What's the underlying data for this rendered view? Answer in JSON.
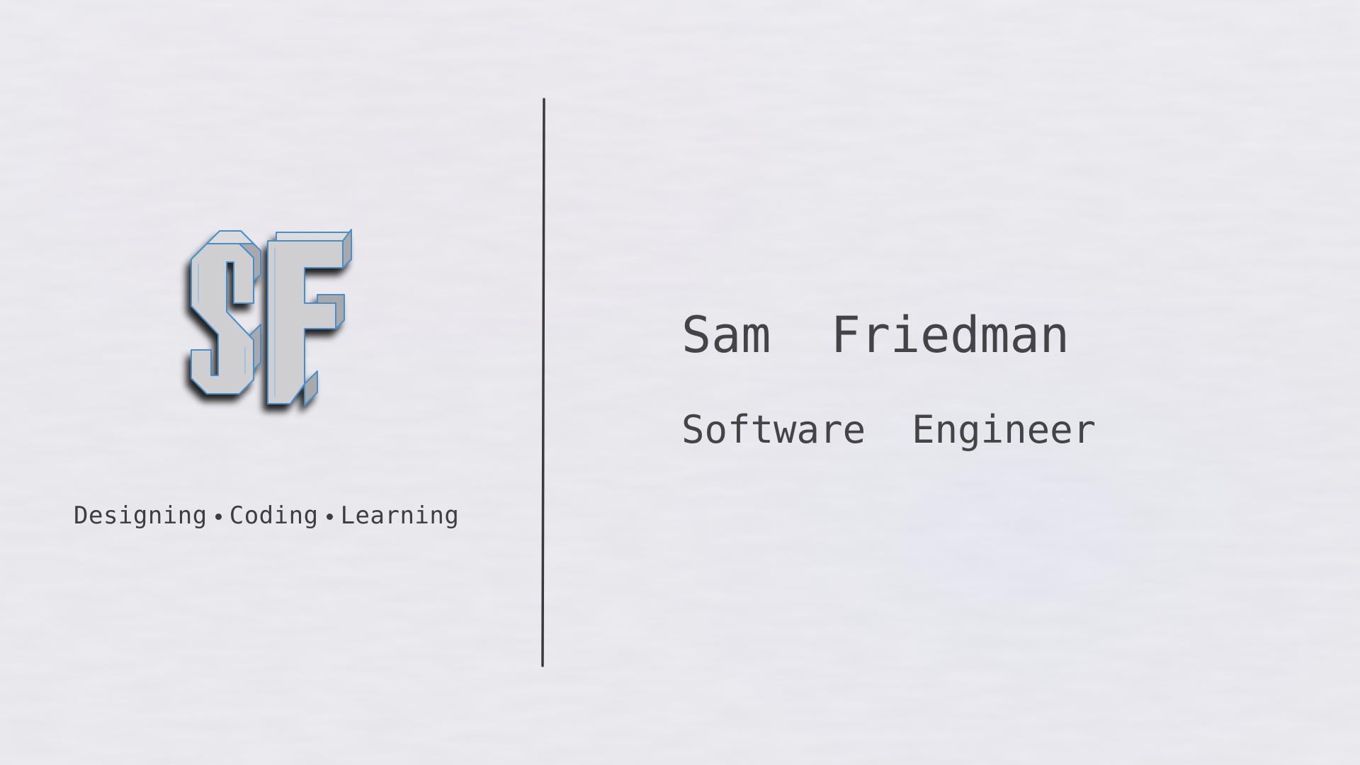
{
  "branding": {
    "monogram": "SF",
    "tagline": {
      "items": [
        "Designing",
        "Coding",
        "Learning"
      ]
    }
  },
  "profile": {
    "name": "Sam  Friedman",
    "title": "Software  Engineer"
  },
  "colors": {
    "background": "#efeef3",
    "text": "#444446",
    "divider": "#3a3a3c",
    "monogram_face": "#cfcfd1",
    "monogram_outline": "#4a8ec9",
    "monogram_shadow": "#1a1a1a"
  }
}
